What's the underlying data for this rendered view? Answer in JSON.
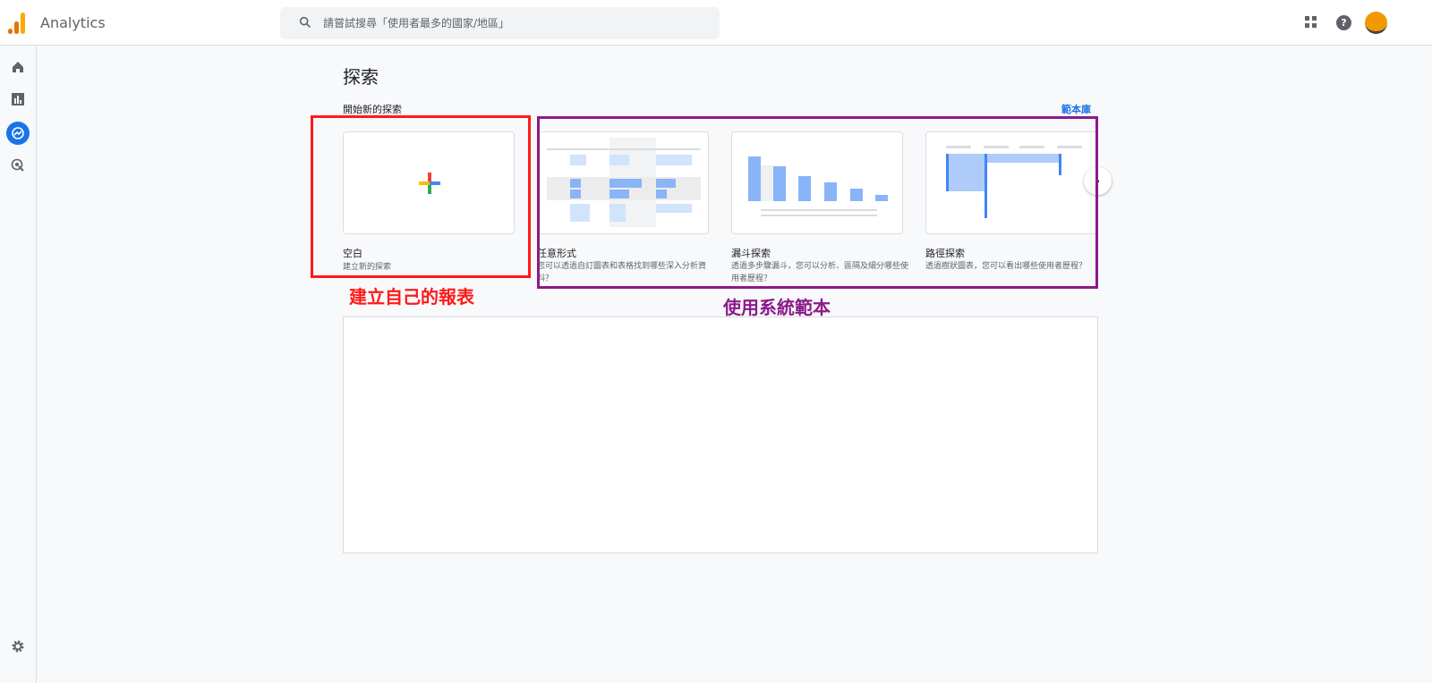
{
  "header": {
    "app_title": "Analytics",
    "search_placeholder": "請嘗試搜尋「使用者最多的國家/地區」",
    "icons": [
      "apps-icon",
      "help-icon",
      "avatar"
    ]
  },
  "sidebar": {
    "items": [
      {
        "name": "home-icon"
      },
      {
        "name": "reports-icon"
      },
      {
        "name": "explore-icon",
        "active": true
      },
      {
        "name": "advertising-icon"
      }
    ],
    "settings": "gear-icon"
  },
  "main": {
    "title": "探索",
    "section_label": "開始新的探索",
    "template_library": "範本庫",
    "cards": [
      {
        "title": "空白",
        "desc": "建立新的探索"
      },
      {
        "title": "任意形式",
        "desc": "您可以透過自訂圖表和表格找到哪些深入分析資料？"
      },
      {
        "title": "漏斗探索",
        "desc": "透過多步驟漏斗，您可以分析、區隔及細分哪些使用者歷程？"
      },
      {
        "title": "路徑探索",
        "desc": "透過樹狀圖表，您可以看出哪些使用者歷程？"
      }
    ]
  },
  "annotations": {
    "own_report": "建立自己的報表",
    "system_templates": "使用系統範本",
    "red": "#ff1a1a",
    "purple": "#8b1a8b"
  },
  "colors": {
    "accent": "#1a73e8"
  }
}
